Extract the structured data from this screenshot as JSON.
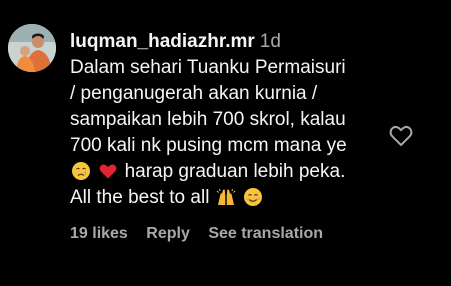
{
  "comment": {
    "username": "luqman_hadiazhr.mr",
    "timestamp": "1d",
    "lines": [
      "Dalam sehari Tuanku Permaisuri",
      "/ penganugerah akan kurnia /",
      "sampaikan lebih 700 skrol, kalau",
      "700 kali nk pusing mcm mana ye",
      "harap graduan lebih peka.",
      "All the best to all"
    ],
    "emojis": {
      "line5_first": "crying-face-emoji",
      "line5_second": "red-heart-emoji",
      "line6": [
        "raising-hands-emoji",
        "smiling-face-emoji"
      ]
    }
  },
  "actions": {
    "likes": "19 likes",
    "reply": "Reply",
    "see_translation": "See translation"
  },
  "icons": {
    "like": "heart-outline-icon"
  },
  "colors": {
    "background": "#000000",
    "text": "#f5f5f5",
    "secondary": "#a8a8a8"
  }
}
